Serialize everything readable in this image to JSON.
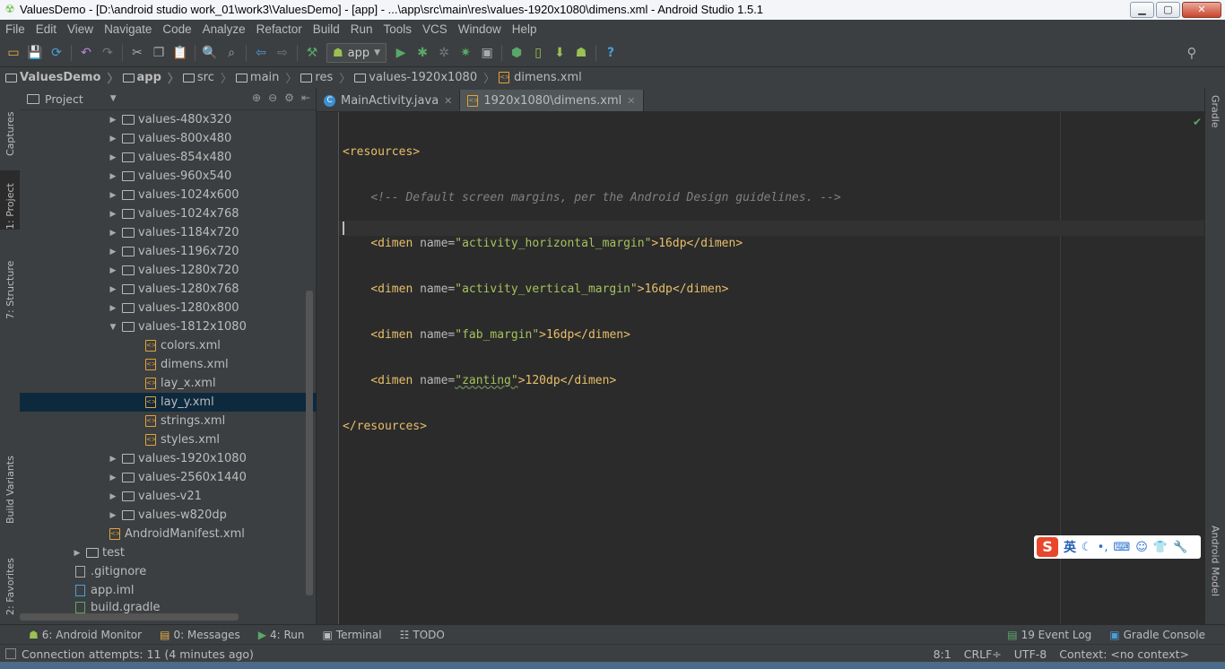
{
  "window": {
    "title": "ValuesDemo - [D:\\android studio work_01\\work3\\ValuesDemo] - [app] - ...\\app\\src\\main\\res\\values-1920x1080\\dimens.xml - Android Studio 1.5.1",
    "app_icon": "android-studio-icon"
  },
  "menu": [
    "File",
    "Edit",
    "View",
    "Navigate",
    "Code",
    "Analyze",
    "Refactor",
    "Build",
    "Run",
    "Tools",
    "VCS",
    "Window",
    "Help"
  ],
  "toolbar": {
    "run_config": "app"
  },
  "breadcrumbs": [
    {
      "label": "ValuesDemo"
    },
    {
      "label": "app"
    },
    {
      "label": "src"
    },
    {
      "label": "main"
    },
    {
      "label": "res"
    },
    {
      "label": "values-1920x1080"
    },
    {
      "label": "dimens.xml"
    }
  ],
  "left_strip": {
    "captures": "Captures",
    "project": "1: Project",
    "structure": "7: Structure",
    "build_variants": "Build Variants",
    "favorites": "2: Favorites"
  },
  "right_strip": {
    "gradle": "Gradle",
    "android_model": "Android Model"
  },
  "project_panel": {
    "title": "Project",
    "tree": [
      {
        "label": "values-480x320",
        "type": "folder",
        "expanded": false
      },
      {
        "label": "values-800x480",
        "type": "folder",
        "expanded": false
      },
      {
        "label": "values-854x480",
        "type": "folder",
        "expanded": false
      },
      {
        "label": "values-960x540",
        "type": "folder",
        "expanded": false
      },
      {
        "label": "values-1024x600",
        "type": "folder",
        "expanded": false
      },
      {
        "label": "values-1024x768",
        "type": "folder",
        "expanded": false
      },
      {
        "label": "values-1184x720",
        "type": "folder",
        "expanded": false
      },
      {
        "label": "values-1196x720",
        "type": "folder",
        "expanded": false
      },
      {
        "label": "values-1280x720",
        "type": "folder",
        "expanded": false
      },
      {
        "label": "values-1280x768",
        "type": "folder",
        "expanded": false
      },
      {
        "label": "values-1280x800",
        "type": "folder",
        "expanded": false
      },
      {
        "label": "values-1812x1080",
        "type": "folder",
        "expanded": true
      },
      {
        "label": "colors.xml",
        "type": "xml"
      },
      {
        "label": "dimens.xml",
        "type": "xml"
      },
      {
        "label": "lay_x.xml",
        "type": "xml"
      },
      {
        "label": "lay_y.xml",
        "type": "xml",
        "selected": true
      },
      {
        "label": "strings.xml",
        "type": "xml"
      },
      {
        "label": "styles.xml",
        "type": "xml"
      },
      {
        "label": "values-1920x1080",
        "type": "folder",
        "expanded": false
      },
      {
        "label": "values-2560x1440",
        "type": "folder",
        "expanded": false
      },
      {
        "label": "values-v21",
        "type": "folder",
        "expanded": false
      },
      {
        "label": "values-w820dp",
        "type": "folder",
        "expanded": false
      },
      {
        "label": "AndroidManifest.xml",
        "type": "xml"
      },
      {
        "label": "test",
        "type": "folder",
        "expanded": false
      },
      {
        "label": ".gitignore",
        "type": "file"
      },
      {
        "label": "app.iml",
        "type": "file"
      },
      {
        "label": "build.gradle",
        "type": "file"
      }
    ]
  },
  "editor_tabs": [
    {
      "label": "MainActivity.java",
      "icon": "java-class-icon",
      "active": false
    },
    {
      "label": "1920x1080\\dimens.xml",
      "icon": "xml-file-icon",
      "active": true
    }
  ],
  "editor": {
    "lines": {
      "l1_open": "<resources>",
      "l2_comment": "<!-- Default screen margins, per the Android Design guidelines. -->",
      "l3_tag": "<dimen ",
      "l3_attr": "name=",
      "l3_val": "\"activity_horizontal_margin\"",
      "l3_rest": ">16dp</dimen>",
      "l4_tag": "<dimen ",
      "l4_attr": "name=",
      "l4_val": "\"activity_vertical_margin\"",
      "l4_rest": ">16dp</dimen>",
      "l5_tag": "<dimen ",
      "l5_attr": "name=",
      "l5_val": "\"fab_margin\"",
      "l5_rest": ">16dp</dimen>",
      "l6_tag": "<dimen ",
      "l6_attr": "name=",
      "l6_val": "\"zanting\"",
      "l6_rest": ">120dp</dimen>",
      "l7_close": "</resources>"
    }
  },
  "ime": {
    "mode": "英"
  },
  "tool_windows": {
    "android_monitor": "6: Android Monitor",
    "messages": "0: Messages",
    "run": "4: Run",
    "terminal": "Terminal",
    "todo": "TODO",
    "event_log": "19 Event Log",
    "gradle_console": "Gradle Console"
  },
  "status": {
    "message": "Connection attempts: 11 (4 minutes ago)",
    "position": "8:1",
    "line_sep": "CRLF÷",
    "encoding": "UTF-8",
    "context": "Context: <no context>"
  }
}
